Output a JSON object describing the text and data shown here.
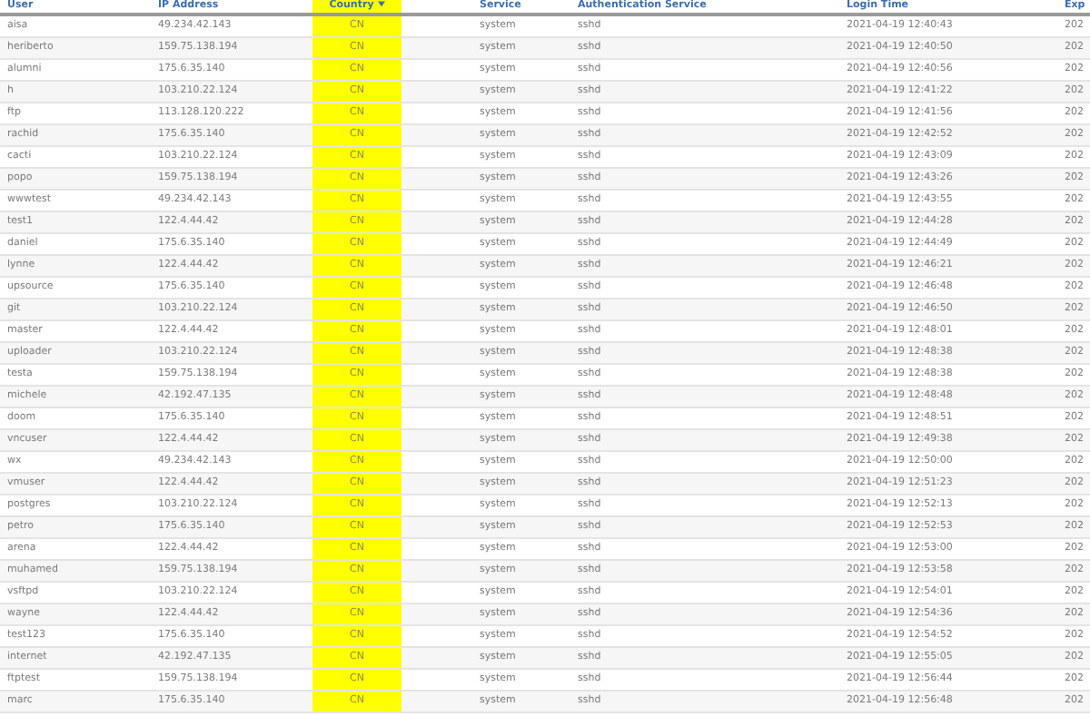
{
  "table": {
    "columns": [
      {
        "label": "User",
        "sorted": false,
        "highlighted": false
      },
      {
        "label": "IP Address",
        "sorted": false,
        "highlighted": false
      },
      {
        "label": "Country",
        "sorted": true,
        "highlighted": true
      },
      {
        "label": "Service",
        "sorted": false,
        "highlighted": false
      },
      {
        "label": "Authentication Service",
        "sorted": false,
        "highlighted": false
      },
      {
        "label": "Login Time",
        "sorted": false,
        "highlighted": false
      },
      {
        "label": "Exp",
        "sorted": false,
        "highlighted": false
      }
    ],
    "rows": [
      [
        "aisa",
        "49.234.42.143",
        "CN",
        "system",
        "sshd",
        "2021-04-19 12:40:43",
        "202"
      ],
      [
        "heriberto",
        "159.75.138.194",
        "CN",
        "system",
        "sshd",
        "2021-04-19 12:40:50",
        "202"
      ],
      [
        "alumni",
        "175.6.35.140",
        "CN",
        "system",
        "sshd",
        "2021-04-19 12:40:56",
        "202"
      ],
      [
        "h",
        "103.210.22.124",
        "CN",
        "system",
        "sshd",
        "2021-04-19 12:41:22",
        "202"
      ],
      [
        "ftp",
        "113.128.120.222",
        "CN",
        "system",
        "sshd",
        "2021-04-19 12:41:56",
        "202"
      ],
      [
        "rachid",
        "175.6.35.140",
        "CN",
        "system",
        "sshd",
        "2021-04-19 12:42:52",
        "202"
      ],
      [
        "cacti",
        "103.210.22.124",
        "CN",
        "system",
        "sshd",
        "2021-04-19 12:43:09",
        "202"
      ],
      [
        "popo",
        "159.75.138.194",
        "CN",
        "system",
        "sshd",
        "2021-04-19 12:43:26",
        "202"
      ],
      [
        "wwwtest",
        "49.234.42.143",
        "CN",
        "system",
        "sshd",
        "2021-04-19 12:43:55",
        "202"
      ],
      [
        "test1",
        "122.4.44.42",
        "CN",
        "system",
        "sshd",
        "2021-04-19 12:44:28",
        "202"
      ],
      [
        "daniel",
        "175.6.35.140",
        "CN",
        "system",
        "sshd",
        "2021-04-19 12:44:49",
        "202"
      ],
      [
        "lynne",
        "122.4.44.42",
        "CN",
        "system",
        "sshd",
        "2021-04-19 12:46:21",
        "202"
      ],
      [
        "upsource",
        "175.6.35.140",
        "CN",
        "system",
        "sshd",
        "2021-04-19 12:46:48",
        "202"
      ],
      [
        "git",
        "103.210.22.124",
        "CN",
        "system",
        "sshd",
        "2021-04-19 12:46:50",
        "202"
      ],
      [
        "master",
        "122.4.44.42",
        "CN",
        "system",
        "sshd",
        "2021-04-19 12:48:01",
        "202"
      ],
      [
        "uploader",
        "103.210.22.124",
        "CN",
        "system",
        "sshd",
        "2021-04-19 12:48:38",
        "202"
      ],
      [
        "testa",
        "159.75.138.194",
        "CN",
        "system",
        "sshd",
        "2021-04-19 12:48:38",
        "202"
      ],
      [
        "michele",
        "42.192.47.135",
        "CN",
        "system",
        "sshd",
        "2021-04-19 12:48:48",
        "202"
      ],
      [
        "doom",
        "175.6.35.140",
        "CN",
        "system",
        "sshd",
        "2021-04-19 12:48:51",
        "202"
      ],
      [
        "vncuser",
        "122.4.44.42",
        "CN",
        "system",
        "sshd",
        "2021-04-19 12:49:38",
        "202"
      ],
      [
        "wx",
        "49.234.42.143",
        "CN",
        "system",
        "sshd",
        "2021-04-19 12:50:00",
        "202"
      ],
      [
        "vmuser",
        "122.4.44.42",
        "CN",
        "system",
        "sshd",
        "2021-04-19 12:51:23",
        "202"
      ],
      [
        "postgres",
        "103.210.22.124",
        "CN",
        "system",
        "sshd",
        "2021-04-19 12:52:13",
        "202"
      ],
      [
        "petro",
        "175.6.35.140",
        "CN",
        "system",
        "sshd",
        "2021-04-19 12:52:53",
        "202"
      ],
      [
        "arena",
        "122.4.44.42",
        "CN",
        "system",
        "sshd",
        "2021-04-19 12:53:00",
        "202"
      ],
      [
        "muhamed",
        "159.75.138.194",
        "CN",
        "system",
        "sshd",
        "2021-04-19 12:53:58",
        "202"
      ],
      [
        "vsftpd",
        "103.210.22.124",
        "CN",
        "system",
        "sshd",
        "2021-04-19 12:54:01",
        "202"
      ],
      [
        "wayne",
        "122.4.44.42",
        "CN",
        "system",
        "sshd",
        "2021-04-19 12:54:36",
        "202"
      ],
      [
        "test123",
        "175.6.35.140",
        "CN",
        "system",
        "sshd",
        "2021-04-19 12:54:52",
        "202"
      ],
      [
        "internet",
        "42.192.47.135",
        "CN",
        "system",
        "sshd",
        "2021-04-19 12:55:05",
        "202"
      ],
      [
        "ftptest",
        "159.75.138.194",
        "CN",
        "system",
        "sshd",
        "2021-04-19 12:56:44",
        "202"
      ],
      [
        "marc",
        "175.6.35.140",
        "CN",
        "system",
        "sshd",
        "2021-04-19 12:56:48",
        "202"
      ]
    ]
  }
}
